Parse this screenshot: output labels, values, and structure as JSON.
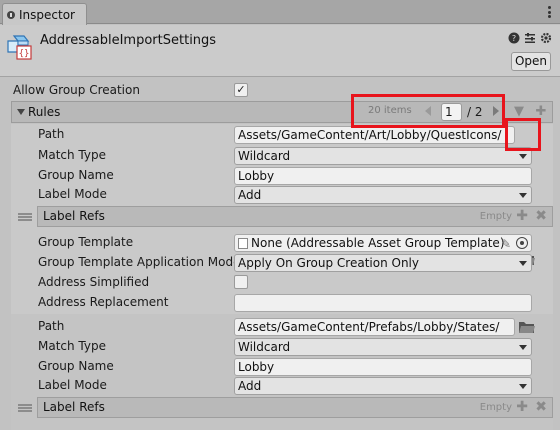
{
  "window": {
    "tab_label": "Inspector"
  },
  "header": {
    "asset_name": "AddressableImportSettings",
    "open_label": "Open",
    "icons": [
      "help-icon",
      "settings-sliders-icon",
      "gear-icon"
    ]
  },
  "settings": {
    "allow_group_creation_label": "Allow Group Creation",
    "allow_group_creation": "✓"
  },
  "rules": {
    "label": "Rules",
    "pager": {
      "items_text": "20 items",
      "current_page": "1",
      "total_text": "/ 2"
    },
    "list": [
      {
        "path_label": "Path",
        "path": "Assets/GameContent/Art/Lobby/QuestIcons/",
        "match_type_label": "Match Type",
        "match_type": "Wildcard",
        "group_name_label": "Group Name",
        "group_name": "Lobby",
        "label_mode_label": "Label Mode",
        "label_mode": "Add",
        "label_refs_label": "Label Refs",
        "label_refs_empty": "Empty",
        "group_template_label": "Group Template",
        "group_template": "None (Addressable Asset Group Template)",
        "group_template_app_label": "Group Template Application Mode",
        "group_template_app": "Apply On Group Creation Only",
        "address_simplified_label": "Address Simplified",
        "address_replacement_label": "Address Replacement",
        "address_replacement": ""
      },
      {
        "path_label": "Path",
        "path": "Assets/GameContent/Prefabs/Lobby/States/",
        "match_type_label": "Match Type",
        "match_type": "Wildcard",
        "group_name_label": "Group Name",
        "group_name": "Lobby",
        "label_mode_label": "Label Mode",
        "label_mode": "Add",
        "label_refs_label": "Label Refs",
        "label_refs_empty": "Empty"
      }
    ]
  },
  "highlight_color": "#e8141c"
}
